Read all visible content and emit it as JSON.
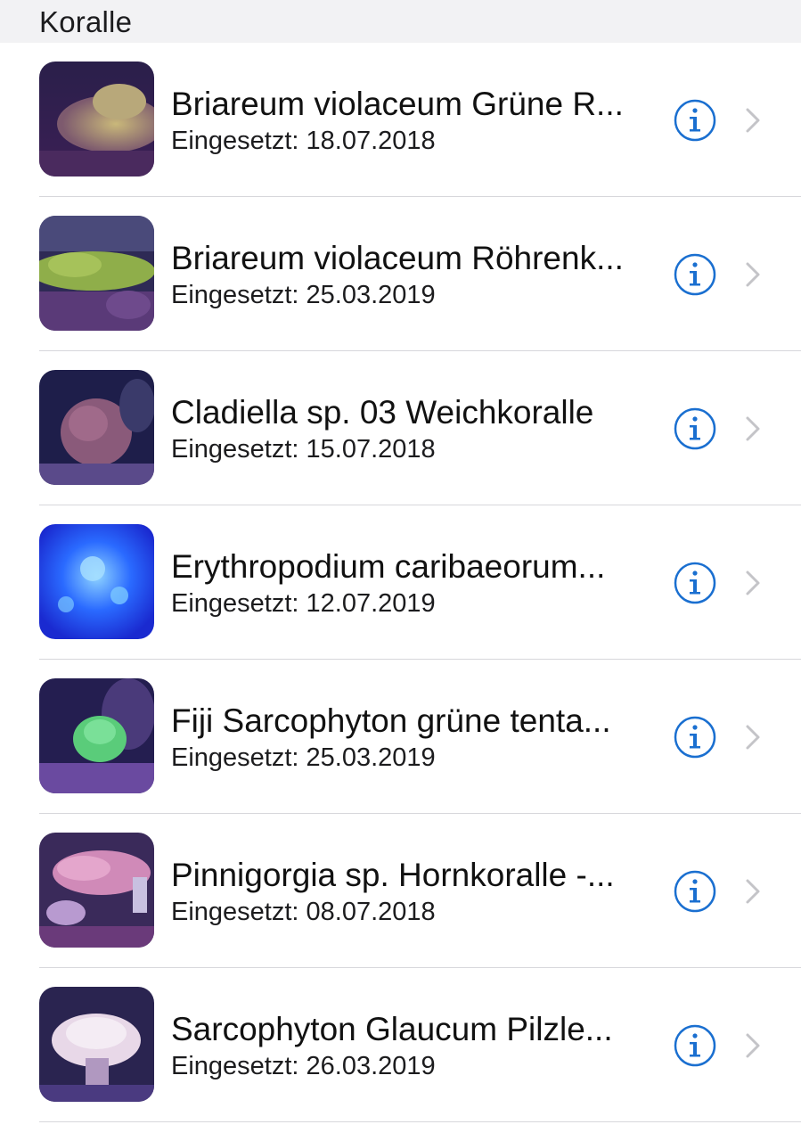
{
  "section": {
    "title": "Koralle"
  },
  "colors": {
    "accent": "#1a6fd0",
    "chevron": "#c4c4c8",
    "separator": "#d7d7db",
    "header_bg": "#f2f2f4"
  },
  "items": [
    {
      "title": "Briareum violaceum Grüne R...",
      "subtitle": "Eingesetzt: 18.07.2018",
      "thumbnail": "coral-photo-briareum-green",
      "info_icon": "info-circle-icon",
      "chevron_icon": "chevron-right-icon"
    },
    {
      "title": "Briareum violaceum Röhrenk...",
      "subtitle": "Eingesetzt: 25.03.2019",
      "thumbnail": "coral-photo-briareum-tube",
      "info_icon": "info-circle-icon",
      "chevron_icon": "chevron-right-icon"
    },
    {
      "title": "Cladiella sp. 03 Weichkoralle",
      "subtitle": "Eingesetzt: 15.07.2018",
      "thumbnail": "coral-photo-cladiella",
      "info_icon": "info-circle-icon",
      "chevron_icon": "chevron-right-icon"
    },
    {
      "title": "Erythropodium caribaeorum...",
      "subtitle": "Eingesetzt: 12.07.2019",
      "thumbnail": "coral-photo-erythropodium",
      "info_icon": "info-circle-icon",
      "chevron_icon": "chevron-right-icon"
    },
    {
      "title": "Fiji Sarcophyton grüne tenta...",
      "subtitle": "Eingesetzt: 25.03.2019",
      "thumbnail": "coral-photo-fiji-sarcophyton",
      "info_icon": "info-circle-icon",
      "chevron_icon": "chevron-right-icon"
    },
    {
      "title": "Pinnigorgia sp. Hornkoralle -...",
      "subtitle": "Eingesetzt: 08.07.2018",
      "thumbnail": "coral-photo-pinnigorgia",
      "info_icon": "info-circle-icon",
      "chevron_icon": "chevron-right-icon"
    },
    {
      "title": "Sarcophyton Glaucum Pilzle...",
      "subtitle": "Eingesetzt: 26.03.2019",
      "thumbnail": "coral-photo-sarcophyton-glaucum",
      "info_icon": "info-circle-icon",
      "chevron_icon": "chevron-right-icon"
    }
  ]
}
